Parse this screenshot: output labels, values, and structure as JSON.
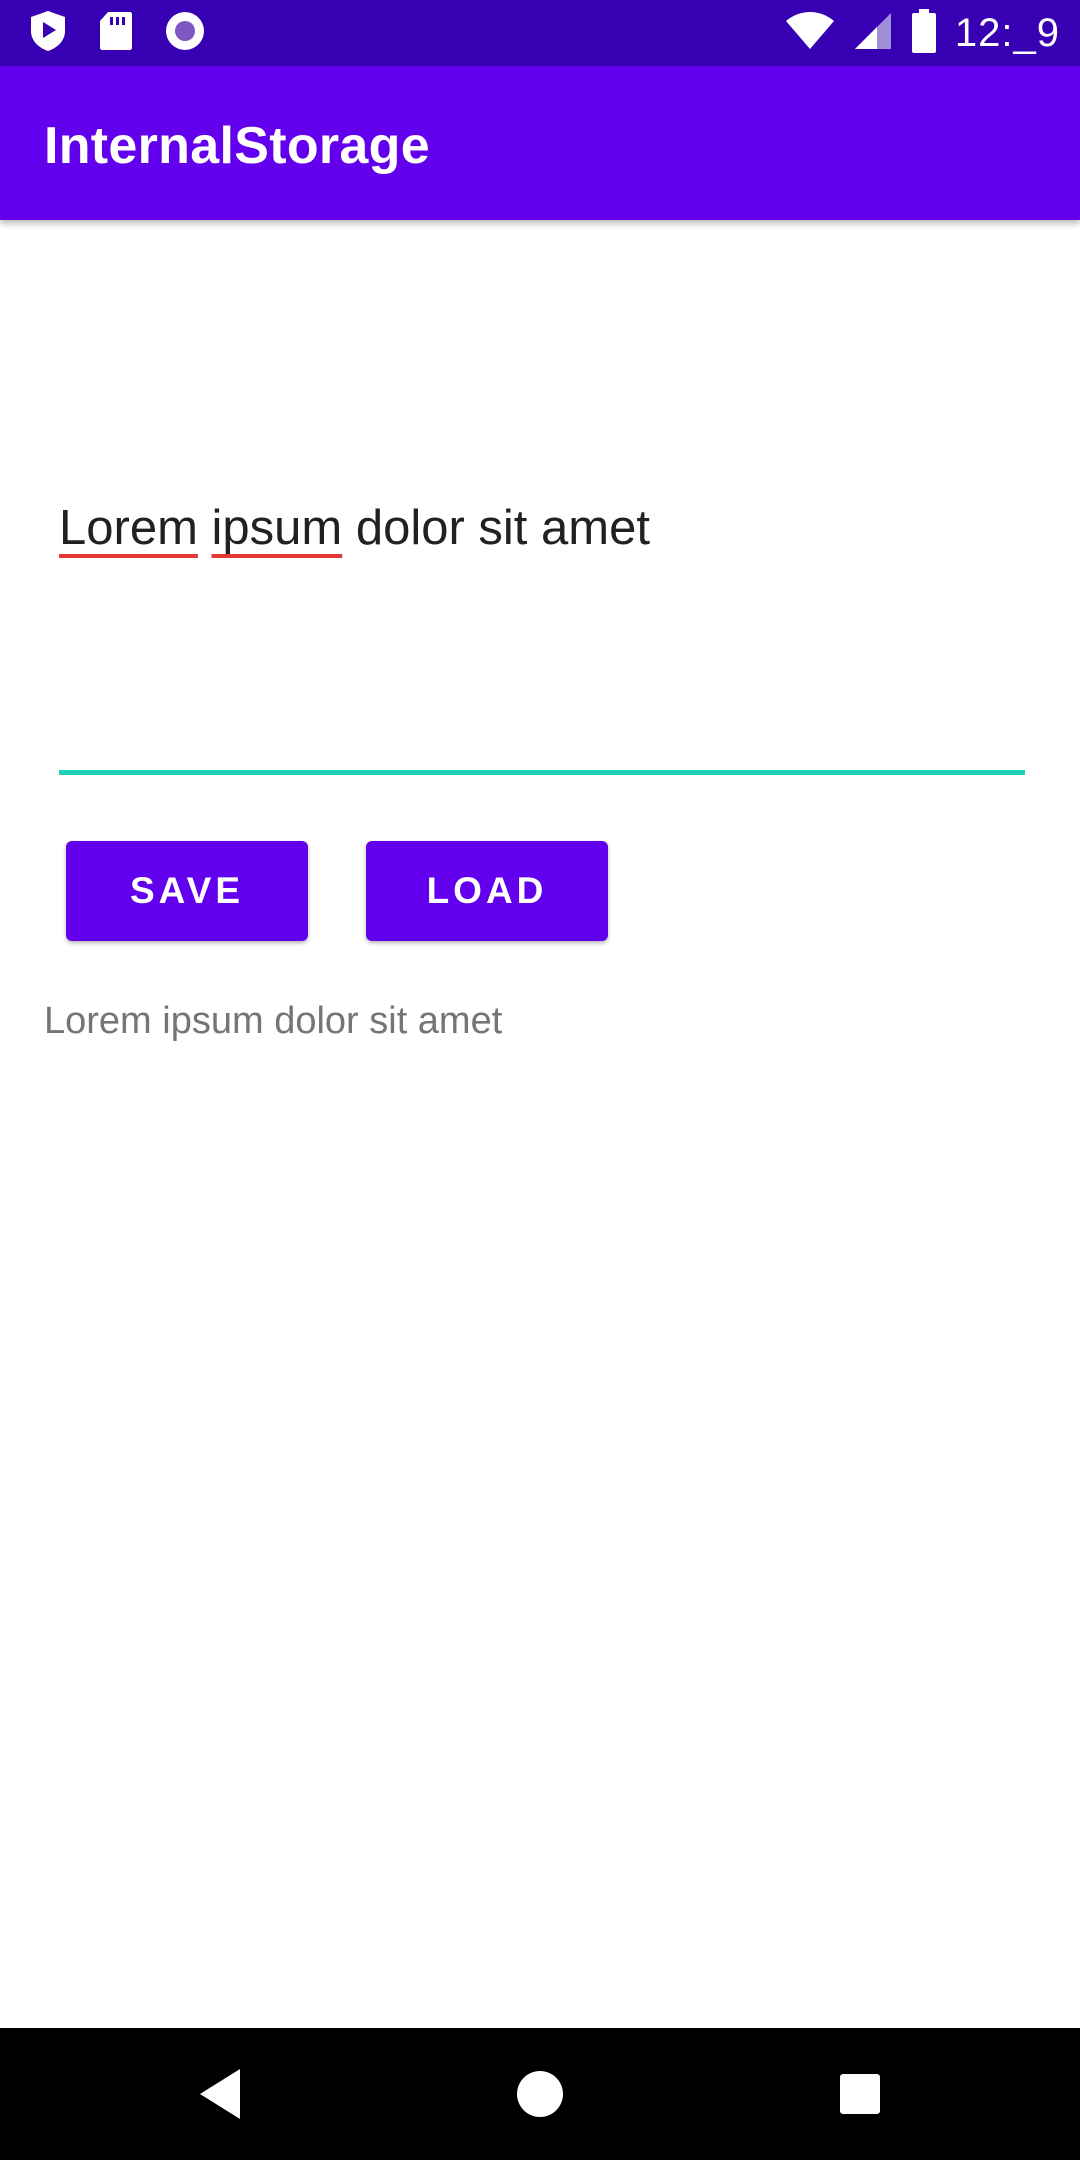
{
  "status_bar": {
    "time": "12:_9",
    "icons": [
      "shield-icon",
      "sd-card-icon",
      "radio-dot-icon",
      "wifi-icon",
      "cell-signal-icon",
      "battery-icon"
    ],
    "background": "#3700b3"
  },
  "app_bar": {
    "title": "InternalStorage",
    "background": "#6200ee"
  },
  "editor": {
    "word1": "Lorem",
    "word2": "ipsum",
    "rest": " dolor sit amet",
    "underline_color": "#1fd1b9",
    "spellcheck_color": "#e53935"
  },
  "buttons": {
    "save_label": "SAVE",
    "load_label": "LOAD",
    "color": "#6200ee"
  },
  "output": {
    "text": "Lorem ipsum dolor sit amet"
  },
  "nav_bar": {
    "icons": [
      "back-icon",
      "home-icon",
      "recents-icon"
    ]
  }
}
